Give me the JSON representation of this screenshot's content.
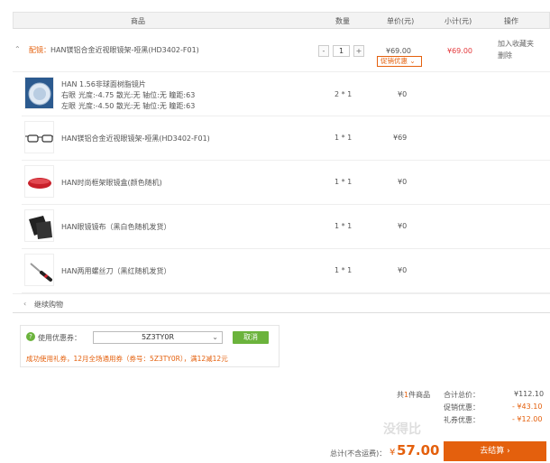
{
  "header": {
    "product": "商品",
    "qty": "数量",
    "unit_price": "单价(元)",
    "subtotal": "小计(元)",
    "action": "操作"
  },
  "main_item": {
    "prefix": "配镜：",
    "name": "HAN镁铝合金近视眼镜架-哑黑(HD3402-F01)",
    "qty_minus": "-",
    "qty": "1",
    "qty_plus": "+",
    "unit_price": "¥69.00",
    "promo_tag": "促销优惠",
    "subtotal": "¥69.00",
    "add_favorite": "加入收藏夹",
    "delete": "删除"
  },
  "sub_items": [
    {
      "name": "HAN 1.56非球面树脂镜片",
      "right_label": "右眼",
      "right_spec": "光度:-4.75 散光:无 轴位:无 瞳距:63",
      "left_label": "左眼",
      "left_spec": "光度:-4.50 散光:无 轴位:无 瞳距:63",
      "qty": "2 * 1",
      "price": "¥0"
    },
    {
      "name": "HAN镁铝合金近视眼镜架-哑黑(HD3402-F01)",
      "qty": "1 * 1",
      "price": "¥69"
    },
    {
      "name": "HAN时尚框架眼镜盒(颜色随机)",
      "qty": "1 * 1",
      "price": "¥0"
    },
    {
      "name": "HAN眼镜镜布（黑白色随机发货）",
      "qty": "1 * 1",
      "price": "¥0"
    },
    {
      "name": "HAN两用螺丝刀（黑红随机发货）",
      "qty": "1 * 1",
      "price": "¥0"
    }
  ],
  "continue_shopping": "继续购物",
  "coupon": {
    "label": "使用优惠券：",
    "selected": "5Z3TY0R",
    "cancel": "取消",
    "notice": "成功使用礼券，12月全场通用券（券号：5Z3TY0R），满12减12元"
  },
  "summary": {
    "count_prefix": "共",
    "count": "1",
    "count_suffix": "件商品",
    "total_label": "合计总价：",
    "total": "¥112.10",
    "promo_label": "促销优惠：",
    "promo": "- ¥43.10",
    "gift_label": "礼券优惠：",
    "gift": "- ¥12.00",
    "grand_label": "总计(不含运费)：",
    "grand_currency": "¥",
    "grand": "57.00",
    "checkout": "去结算"
  },
  "watermark": "没得比",
  "colors": {
    "accent": "#e4600d",
    "green": "#6bb33c"
  }
}
